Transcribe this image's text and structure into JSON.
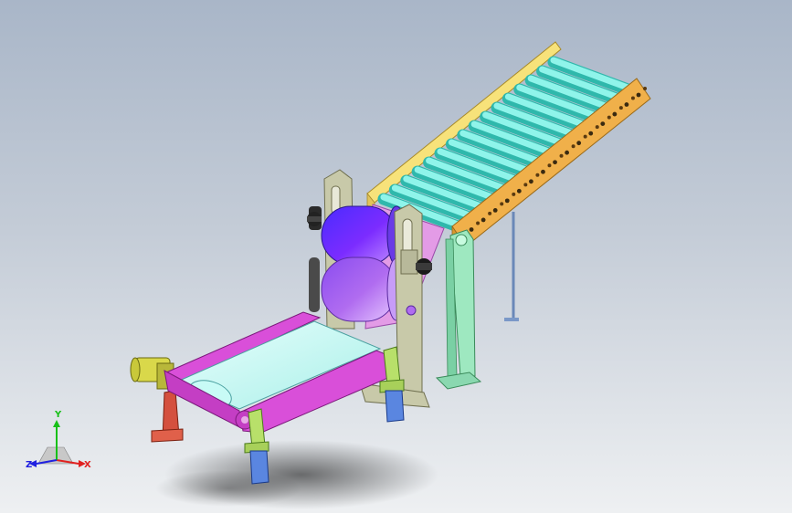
{
  "viewport": {
    "background_top": "#a9b6c8",
    "background_bottom": "#eef0f2"
  },
  "model": {
    "parts": [
      "roller-conveyor",
      "roller-frame",
      "conveyor-support-leg",
      "drive-rollers",
      "side-frame",
      "belt-conveyor",
      "belt-frame",
      "motor",
      "stand-legs"
    ],
    "colors": {
      "roller": "#7ff0e6",
      "frame_orange": "#f0b04a",
      "frame_yellow": "#f7e27a",
      "support_green": "#9ee8c0",
      "drum_purple": "#7b2cff",
      "drum_violet": "#b06cf0",
      "plate_grey": "#c8c9a9",
      "belt_magenta": "#d94fd9",
      "belt_surface": "#c8fbf6",
      "motor_yellow": "#d9d84a",
      "leg_red": "#d4503e",
      "foot_blue": "#5a86e0",
      "bracket_green": "#b8e06a"
    }
  },
  "triad": {
    "x_label": "X",
    "y_label": "Y",
    "z_label": "Z",
    "x_color": "#e02020",
    "y_color": "#18c018",
    "z_color": "#2020e0"
  }
}
